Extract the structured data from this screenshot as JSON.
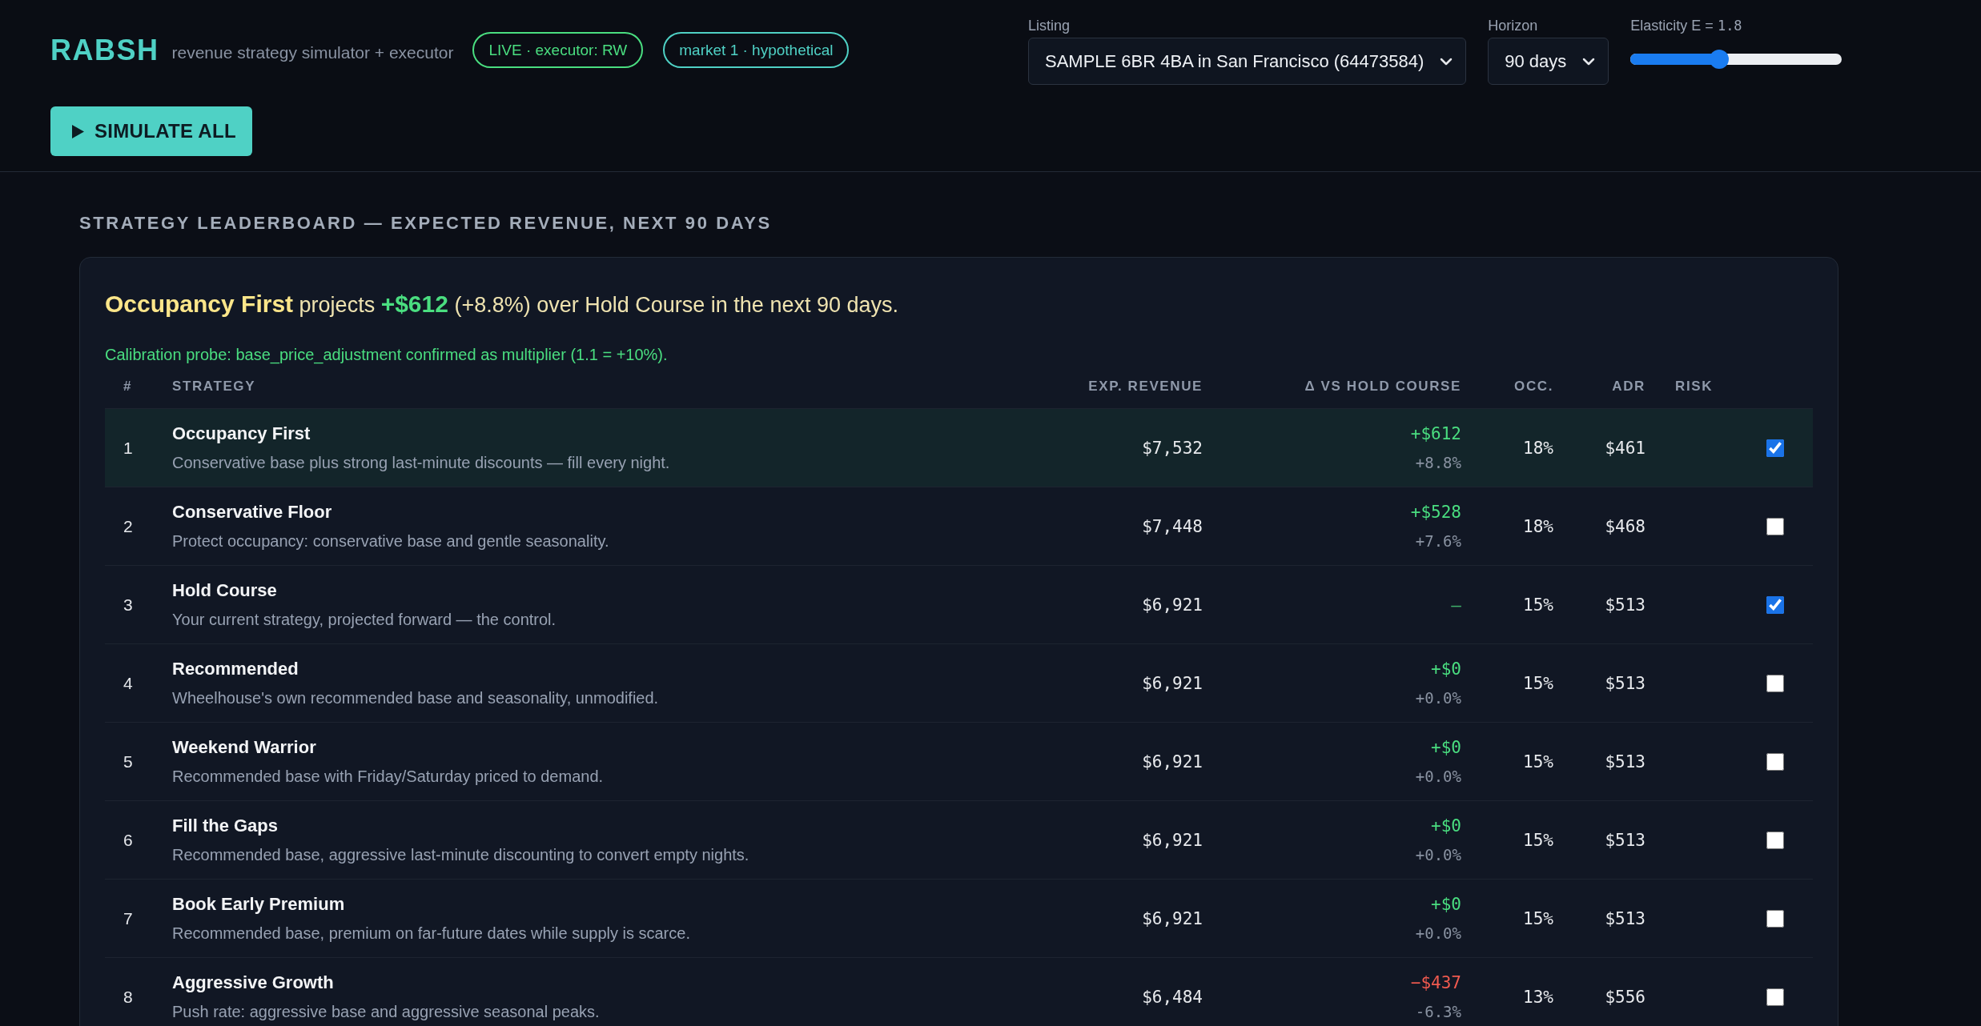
{
  "header": {
    "logo": "RABSH",
    "tagline": "revenue strategy simulator + executor",
    "badges": [
      {
        "label": "LIVE · executor: RW",
        "color": "#4ade80"
      },
      {
        "label": "market 1 · hypothetical",
        "color": "#4fd1c5"
      }
    ],
    "simulate_button": {
      "label": "SIMULATE ALL"
    },
    "listing": {
      "label": "Listing",
      "value": "SAMPLE 6BR 4BA in San Francisco (64473584)"
    },
    "horizon": {
      "label": "Horizon",
      "value": "90 days"
    },
    "elasticity": {
      "label": "Elasticity E =",
      "value": "1.8",
      "level": 0.42
    }
  },
  "leaderboard": {
    "title": "STRATEGY LEADERBOARD — EXPECTED REVENUE, NEXT 90 DAYS",
    "headline": {
      "lead": "Occupancy First",
      "verb": "projects",
      "amount": "+$612",
      "rest": "(+8.8%) over Hold Course in the next 90 days."
    },
    "calibration_note": "Calibration probe: base_price_adjustment confirmed as multiplier (1.1 = +10%).",
    "columns": [
      "#",
      "STRATEGY",
      "EXP. REVENUE",
      "Δ VS HOLD COURSE",
      "OCC.",
      "ADR",
      "RISK"
    ],
    "rows": [
      {
        "rank": "1",
        "name": "Occupancy First",
        "description": "Conservative base plus strong last-minute discounts — fill every night.",
        "revenue": "$7,532",
        "delta": {
          "amount": "+$612",
          "percent": "+8.8%",
          "color": "#4ade80"
        },
        "occupancy": "18%",
        "adr": "$461",
        "highlighted": true,
        "checked": true
      },
      {
        "rank": "2",
        "name": "Conservative Floor",
        "description": "Protect occupancy: conservative base and gentle seasonality.",
        "revenue": "$7,448",
        "delta": {
          "amount": "+$528",
          "percent": "+7.6%",
          "color": "#4ade80"
        },
        "occupancy": "18%",
        "adr": "$468",
        "highlighted": false,
        "checked": false
      },
      {
        "rank": "3",
        "name": "Hold Course",
        "description": "Your current strategy, projected forward — the control.",
        "revenue": "$6,921",
        "delta": {
          "amount": "–",
          "color": "#3fae6a"
        },
        "occupancy": "15%",
        "adr": "$513",
        "highlighted": false,
        "checked": true
      },
      {
        "rank": "4",
        "name": "Recommended",
        "description": "Wheelhouse's own recommended base and seasonality, unmodified.",
        "revenue": "$6,921",
        "delta": {
          "amount": "+$0",
          "percent": "+0.0%",
          "color": "#4ade80"
        },
        "occupancy": "15%",
        "adr": "$513",
        "highlighted": false,
        "checked": false
      },
      {
        "rank": "5",
        "name": "Weekend Warrior",
        "description": "Recommended base with Friday/Saturday priced to demand.",
        "revenue": "$6,921",
        "delta": {
          "amount": "+$0",
          "percent": "+0.0%",
          "color": "#4ade80"
        },
        "occupancy": "15%",
        "adr": "$513",
        "highlighted": false,
        "checked": false
      },
      {
        "rank": "6",
        "name": "Fill the Gaps",
        "description": "Recommended base, aggressive last-minute discounting to convert empty nights.",
        "revenue": "$6,921",
        "delta": {
          "amount": "+$0",
          "percent": "+0.0%",
          "color": "#4ade80"
        },
        "occupancy": "15%",
        "adr": "$513",
        "highlighted": false,
        "checked": false
      },
      {
        "rank": "7",
        "name": "Book Early Premium",
        "description": "Recommended base, premium on far-future dates while supply is scarce.",
        "revenue": "$6,921",
        "delta": {
          "amount": "+$0",
          "percent": "+0.0%",
          "color": "#4ade80"
        },
        "occupancy": "15%",
        "adr": "$513",
        "highlighted": false,
        "checked": false
      },
      {
        "rank": "8",
        "name": "Aggressive Growth",
        "description": "Push rate: aggressive base and aggressive seasonal peaks.",
        "revenue": "$6,484",
        "delta": {
          "amount": "−$437",
          "percent": "-6.3%",
          "color": "#f05a4f"
        },
        "occupancy": "13%",
        "adr": "$556",
        "highlighted": false,
        "checked": false
      }
    ]
  }
}
